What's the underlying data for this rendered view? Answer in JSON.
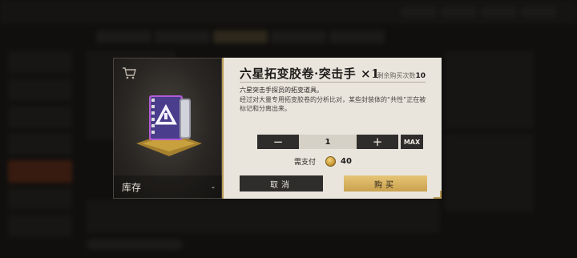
{
  "dialog": {
    "title": "六星拓变胶卷·突击手",
    "quantity_suffix": "×1",
    "remaining_label": "剩余购买次数",
    "remaining_value": "10",
    "description_line1": "六星突击手探员的拓变道具。",
    "description_line2": "经过对大量专用拓变胶卷的分析比对，某些封装体的“共性”正在被标记和分离出来。",
    "stock_label": "库存",
    "stock_value": "-",
    "quantity": {
      "minus_label": "−",
      "value": "1",
      "plus_label": "+",
      "max_label": "MAX"
    },
    "payment": {
      "label": "需支付",
      "amount": "40",
      "currency_icon": "gold-coin-icon"
    },
    "cancel_label": "取消",
    "buy_label": "购买"
  },
  "colors": {
    "panel_bg": "#e9e5dd",
    "dark_button": "#2f2d2b",
    "gold_button": "#d9b462",
    "accent_gold": "#b99a55"
  }
}
